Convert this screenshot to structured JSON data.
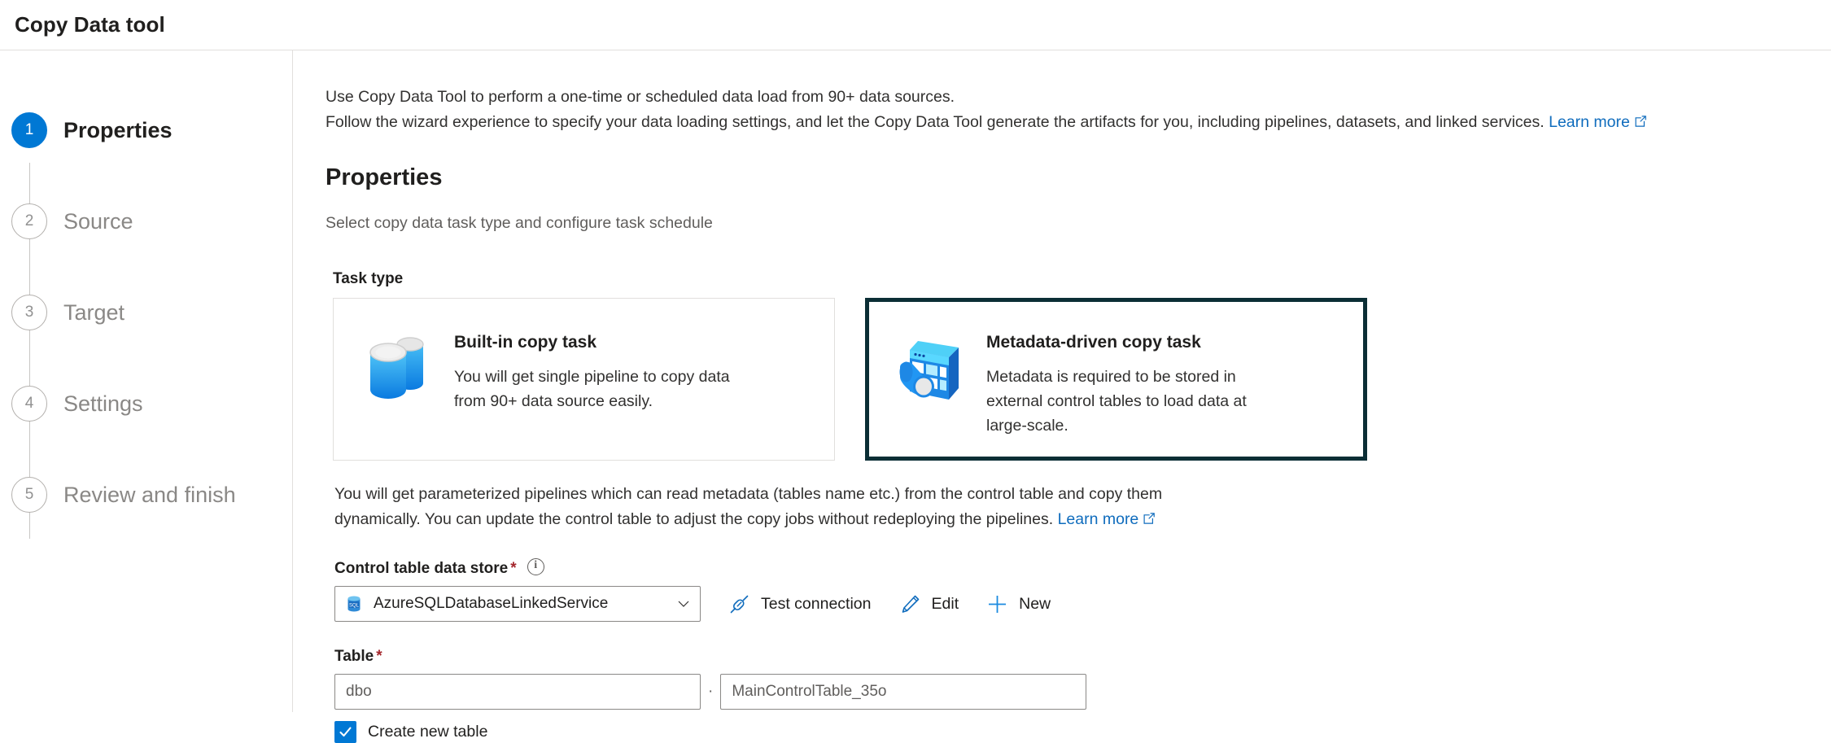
{
  "header": {
    "title": "Copy Data tool"
  },
  "sidebar": {
    "steps": [
      {
        "num": "1",
        "label": "Properties",
        "state": "active"
      },
      {
        "num": "2",
        "label": "Source",
        "state": "inactive"
      },
      {
        "num": "3",
        "label": "Target",
        "state": "inactive"
      },
      {
        "num": "4",
        "label": "Settings",
        "state": "inactive"
      },
      {
        "num": "5",
        "label": "Review and finish",
        "state": "inactive"
      }
    ]
  },
  "intro": {
    "line1": "Use Copy Data Tool to perform a one-time or scheduled data load from 90+ data sources.",
    "line2": "Follow the wizard experience to specify your data loading settings, and let the Copy Data Tool generate the artifacts for you, including pipelines, datasets, and linked services.",
    "learn_more": "Learn more"
  },
  "properties": {
    "title": "Properties",
    "subtitle": "Select copy data task type and configure task schedule",
    "task_type_label": "Task type",
    "cards": [
      {
        "title": "Built-in copy task",
        "desc_line1": "You will get single pipeline to copy data",
        "desc_line2": "from 90+ data source easily.",
        "icon": "database-cylinders-icon",
        "selected": false
      },
      {
        "title": "Metadata-driven copy task",
        "desc_line1": "Metadata is required to be stored in",
        "desc_line2": "external control tables to load data at",
        "desc_line3": "large-scale.",
        "icon": "metadata-table-funnel-icon",
        "selected": true
      }
    ],
    "paragraph_line1": "You will get parameterized pipelines which can read metadata (tables name etc.) from the control table and copy them",
    "paragraph_line2": "dynamically. You can update the control table to adjust the copy jobs without redeploying the pipelines.",
    "paragraph_learn_more": "Learn more"
  },
  "control_table_store": {
    "label": "Control table data store",
    "required_mark": "*",
    "selected_value": "AzureSQLDatabaseLinkedService",
    "test_connection_label": "Test connection",
    "edit_label": "Edit",
    "new_label": "New"
  },
  "table": {
    "label": "Table",
    "required_mark": "*",
    "schema_value": "dbo",
    "separator": "·",
    "name_value": "MainControlTable_35o",
    "create_new_label": "Create new table"
  },
  "colors": {
    "accent": "#0078d4",
    "link": "#0f6cbd",
    "selected_card_border": "#0b2e35",
    "required_red": "#a4262c",
    "muted_text": "#605e5c",
    "border": "#e1dfdd"
  }
}
